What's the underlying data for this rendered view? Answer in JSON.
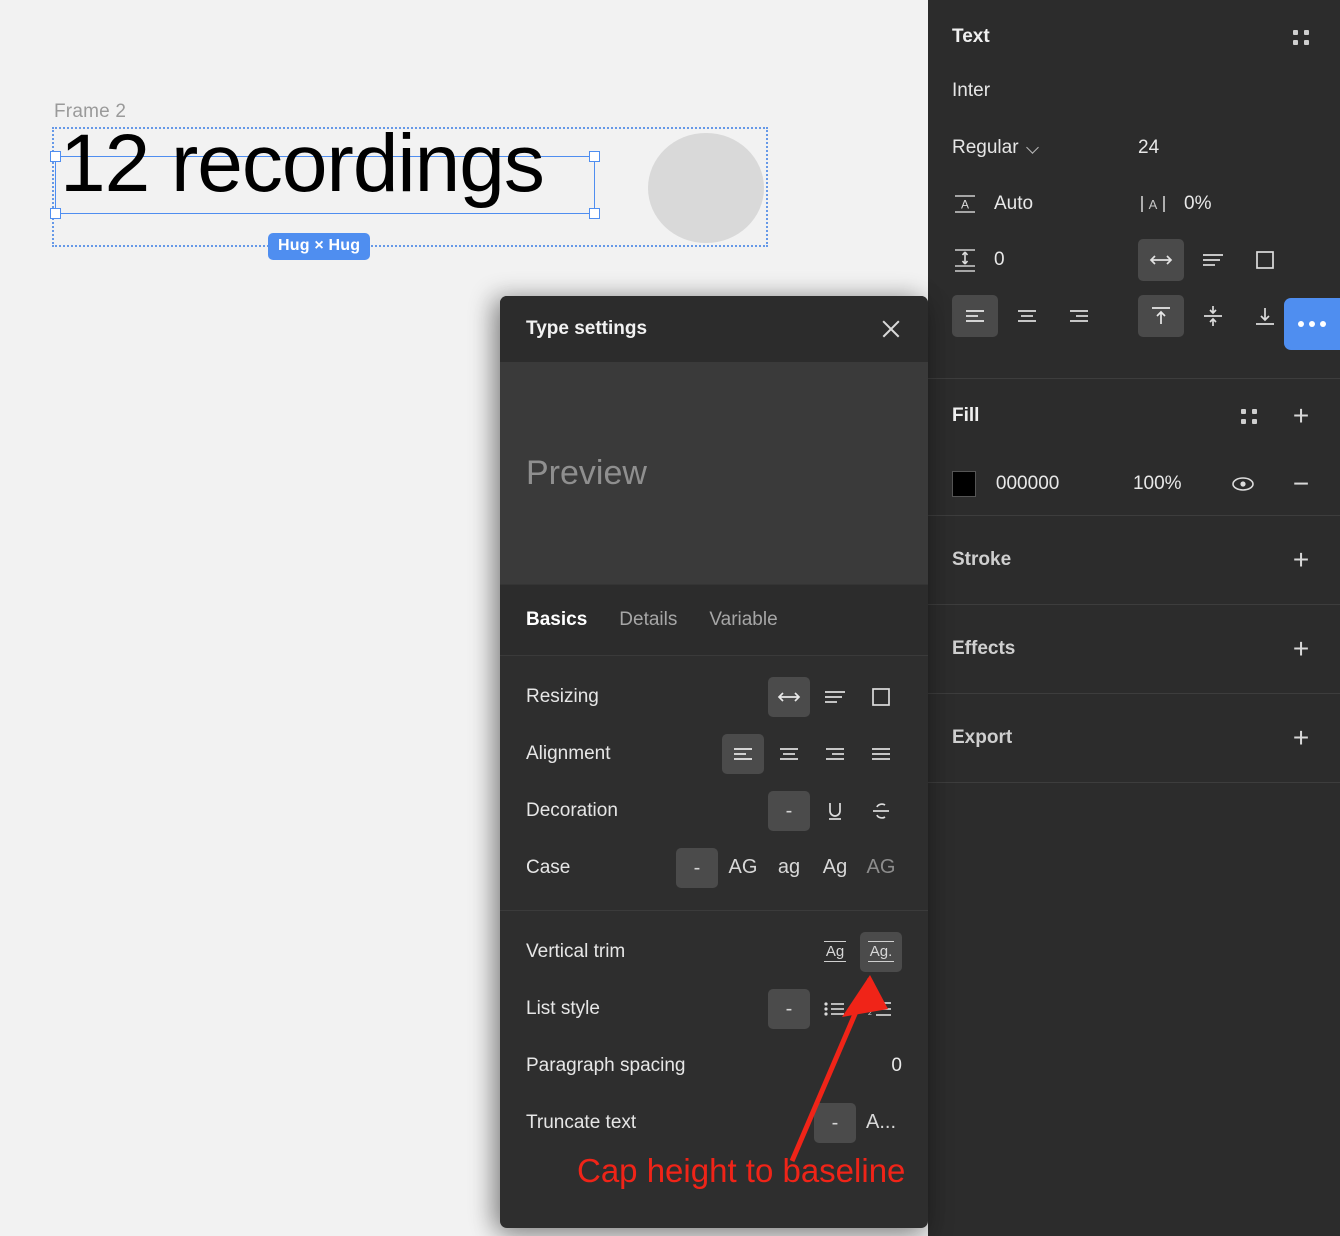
{
  "canvas": {
    "frame_label": "Frame 2",
    "text_value": "12 recordings",
    "hug_badge": "Hug × Hug"
  },
  "right_panel": {
    "text_section": {
      "title": "Text",
      "font_family": "Inter",
      "font_weight": "Regular",
      "font_size": "24",
      "line_height_label": "Auto",
      "letter_spacing_label": "0%",
      "paragraph_spacing": "0"
    },
    "fill_section": {
      "title": "Fill",
      "hex": "000000",
      "opacity": "100%"
    },
    "stroke_section": {
      "title": "Stroke"
    },
    "effects_section": {
      "title": "Effects"
    },
    "export_section": {
      "title": "Export"
    }
  },
  "type_settings": {
    "title": "Type settings",
    "preview_placeholder": "Preview",
    "tabs": [
      {
        "label": "Basics",
        "active": true
      },
      {
        "label": "Details",
        "active": false
      },
      {
        "label": "Variable",
        "active": false
      }
    ],
    "rows": {
      "resizing": "Resizing",
      "alignment": "Alignment",
      "decoration": "Decoration",
      "case": "Case",
      "vertical_trim": "Vertical trim",
      "list_style": "List style",
      "paragraph_spacing": "Paragraph spacing",
      "paragraph_spacing_value": "0",
      "truncate_text": "Truncate text"
    },
    "case_options": {
      "none": "-",
      "upper": "AG",
      "lower": "ag",
      "title": "Ag",
      "small_caps": "AG"
    },
    "decoration_none": "-",
    "list_style_none": "-",
    "truncate_none": "-",
    "truncate_on": "A...",
    "vertical_trim_standard": "Ag",
    "vertical_trim_cap": "Ag."
  },
  "annotation": {
    "text": "Cap height to baseline",
    "color": "#f02418"
  },
  "colors": {
    "canvas_bg": "#f2f2f2",
    "panel_bg": "#2c2c2c",
    "dialog_bg": "#2e2e2e",
    "accent_blue": "#4f8ef0",
    "selection_blue": "#4f8ef0",
    "fill_swatch": "#000000"
  }
}
